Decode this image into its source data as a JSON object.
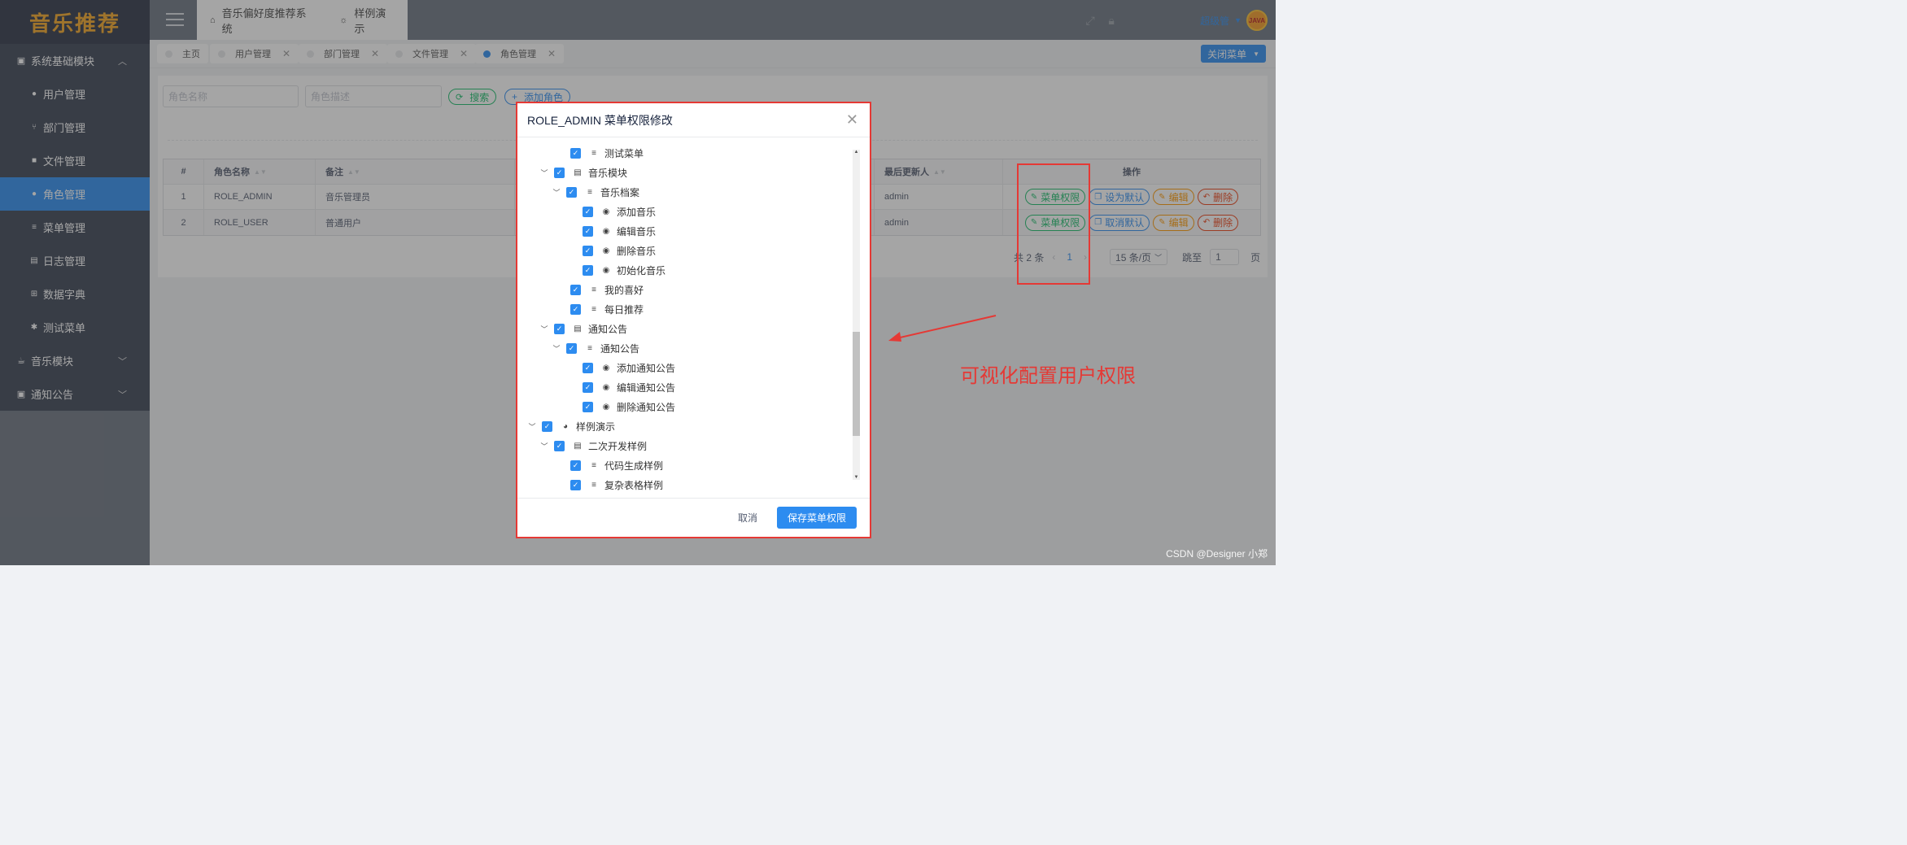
{
  "app": {
    "logo": "音乐推荐"
  },
  "sidebar": {
    "group1": {
      "label": "系统基础模块",
      "icon": "chart-icon"
    },
    "items": [
      {
        "label": "用户管理",
        "icon": "user-icon"
      },
      {
        "label": "部门管理",
        "icon": "branch-icon"
      },
      {
        "label": "文件管理",
        "icon": "folder-icon"
      },
      {
        "label": "角色管理",
        "icon": "users-icon",
        "active": true
      },
      {
        "label": "菜单管理",
        "icon": "list-icon"
      },
      {
        "label": "日志管理",
        "icon": "log-icon"
      },
      {
        "label": "数据字典",
        "icon": "grid-icon"
      },
      {
        "label": "测试菜单",
        "icon": "bug-icon"
      }
    ],
    "group2": {
      "label": "音乐模块",
      "icon": "music-icon"
    },
    "group3": {
      "label": "通知公告",
      "icon": "notice-icon"
    }
  },
  "header": {
    "tabs": [
      {
        "label": "音乐偏好度推荐系统",
        "icon": "home-icon"
      },
      {
        "label": "样例演示",
        "icon": "bulb-icon"
      }
    ],
    "username": "超级管",
    "avatar_text": "JAVA"
  },
  "page_tabs": [
    "主页",
    "用户管理",
    "部门管理",
    "文件管理",
    "角色管理"
  ],
  "close_menu": "关闭菜单",
  "search": {
    "role_name_placeholder": "角色名称",
    "role_desc_placeholder": "角色描述",
    "search_btn": "搜索",
    "add_btn": "添加角色"
  },
  "table": {
    "headers": {
      "index": "#",
      "name": "角色名称",
      "remark": "备注",
      "updater": "最后更新人",
      "ops": "操作"
    },
    "rows": [
      {
        "index": "1",
        "name": "ROLE_ADMIN",
        "remark": "音乐管理员",
        "updater": "admin",
        "ops": [
          "菜单权限",
          "设为默认",
          "编辑",
          "删除"
        ]
      },
      {
        "index": "2",
        "name": "ROLE_USER",
        "remark": "普通用户",
        "updater": "admin",
        "ops": [
          "菜单权限",
          "取消默认",
          "编辑",
          "删除"
        ]
      }
    ]
  },
  "pager": {
    "total": "共 2 条",
    "current": "1",
    "size": "15 条/页",
    "jump": "跳至",
    "jump_value": "1",
    "unit": "页"
  },
  "modal": {
    "title": "ROLE_ADMIN 菜单权限修改",
    "tree": [
      "测试菜单",
      "音乐模块",
      "音乐档案",
      "添加音乐",
      "编辑音乐",
      "删除音乐",
      "初始化音乐",
      "我的喜好",
      "每日推荐",
      "通知公告",
      "通知公告",
      "添加通知公告",
      "编辑通知公告",
      "删除通知公告",
      "样例演示",
      "二次开发样例",
      "代码生成样例",
      "复杂表格样例"
    ],
    "cancel": "取消",
    "save": "保存菜单权限"
  },
  "annotation": {
    "text": "可视化配置用户权限"
  },
  "watermark": "CSDN @Designer 小郑",
  "colors": {
    "primary": "#2d8cf0",
    "success": "#19be6b",
    "warning": "#ff9900",
    "error": "#ed4014",
    "annotation": "#e53935"
  }
}
